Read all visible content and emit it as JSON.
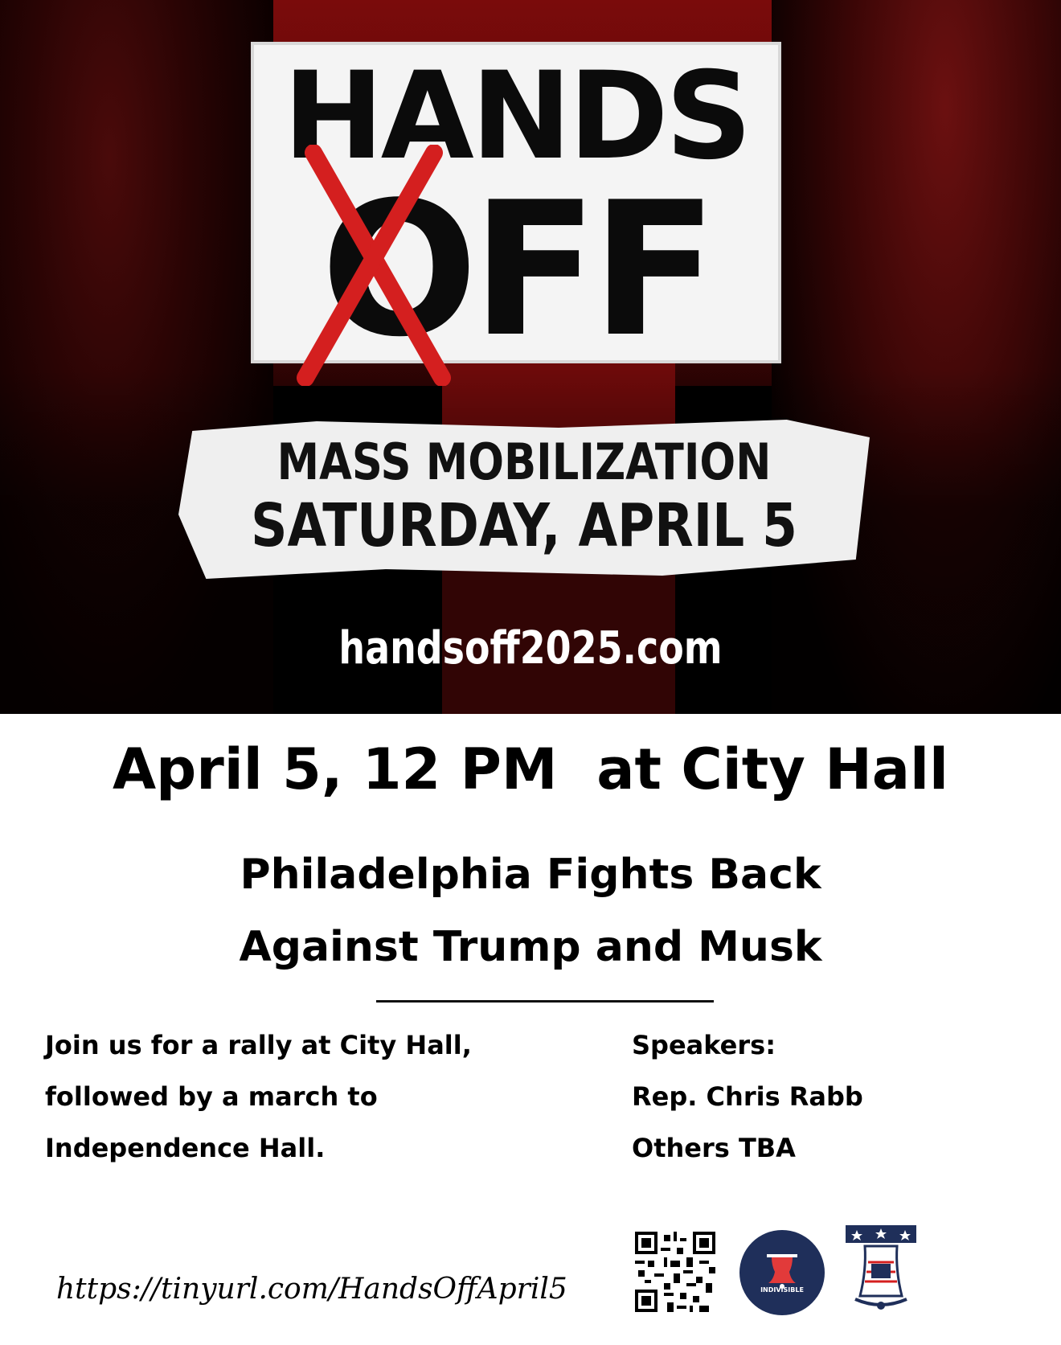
{
  "banner": {
    "hands": "HANDS",
    "off": "OFF",
    "mobilize_line1": "MASS MOBILIZATION",
    "mobilize_line2": "SATURDAY, APRIL 5",
    "website": "handsoff2025.com"
  },
  "event": {
    "headline": "April 5, 12 PM  at City Hall",
    "subhead_line1": "Philadelphia Fights Back",
    "subhead_line2": "Against Trump and Musk"
  },
  "details": {
    "left_lines": [
      "Join us for a rally at City Hall,",
      "followed by a march to",
      "Independence Hall."
    ],
    "right_lines": [
      "Speakers:",
      "Rep. Chris Rabb",
      "Others TBA"
    ]
  },
  "footer": {
    "short_link": "https://tinyurl.com/HandsOffApril5",
    "icons": [
      "qr-code-icon",
      "indivisible-philadelphia-logo",
      "liberty-bell-logo"
    ],
    "logo_text": "INDIVISIBLE"
  },
  "colors": {
    "banner_red": "#6d0a0a",
    "x_red": "#d41f1f",
    "indivisible_navy": "#1f2f5a"
  }
}
